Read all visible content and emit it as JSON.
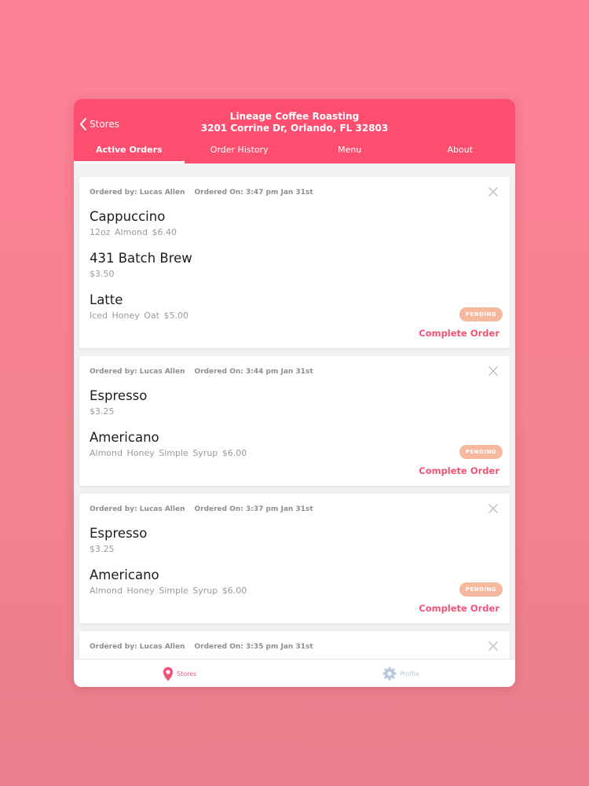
{
  "header": {
    "back_label": "Stores",
    "store_name": "Lineage Coffee Roasting",
    "store_address": "3201 Corrine Dr, Orlando, FL 32803"
  },
  "tabs": [
    {
      "label": "Active Orders",
      "active": true
    },
    {
      "label": "Order History",
      "active": false
    },
    {
      "label": "Menu",
      "active": false
    },
    {
      "label": "About",
      "active": false
    }
  ],
  "orders": [
    {
      "ordered_by": "Ordered by: Lucas  Allen",
      "ordered_on": "Ordered On: 3:47 pm Jan 31st",
      "items": [
        {
          "name": "Cappuccino",
          "details": "12oz  Almond  $6.40"
        },
        {
          "name": "431 Batch Brew",
          "details": "$3.50"
        },
        {
          "name": "Latte",
          "details": "Iced  Honey  Oat  $5.00"
        }
      ],
      "status": "PENDING",
      "action": "Complete Order"
    },
    {
      "ordered_by": "Ordered by: Lucas  Allen",
      "ordered_on": "Ordered On: 3:44 pm Jan 31st",
      "items": [
        {
          "name": "Espresso",
          "details": "$3.25"
        },
        {
          "name": "Americano",
          "details": "Almond  Honey Simple Syrup  $6.00"
        }
      ],
      "status": "PENDING",
      "action": "Complete Order"
    },
    {
      "ordered_by": "Ordered by: Lucas  Allen",
      "ordered_on": "Ordered On: 3:37 pm Jan 31st",
      "items": [
        {
          "name": "Espresso",
          "details": "$3.25"
        },
        {
          "name": "Americano",
          "details": "Almond  Honey Simple Syrup  $6.00"
        }
      ],
      "status": "PENDING",
      "action": "Complete Order"
    },
    {
      "ordered_by": "Ordered by: Lucas  Allen",
      "ordered_on": "Ordered On: 3:35 pm Jan 31st",
      "items": []
    }
  ],
  "bottom_nav": [
    {
      "label": "Stores",
      "icon": "location-pin-icon",
      "active": true,
      "color": "#f05478"
    },
    {
      "label": "Profile",
      "icon": "gear-icon",
      "active": false,
      "color": "#b6c8dc"
    }
  ],
  "colors": {
    "brand": "#fd4e6f",
    "accent": "#f05478",
    "pending_badge": "#f6b99e"
  }
}
